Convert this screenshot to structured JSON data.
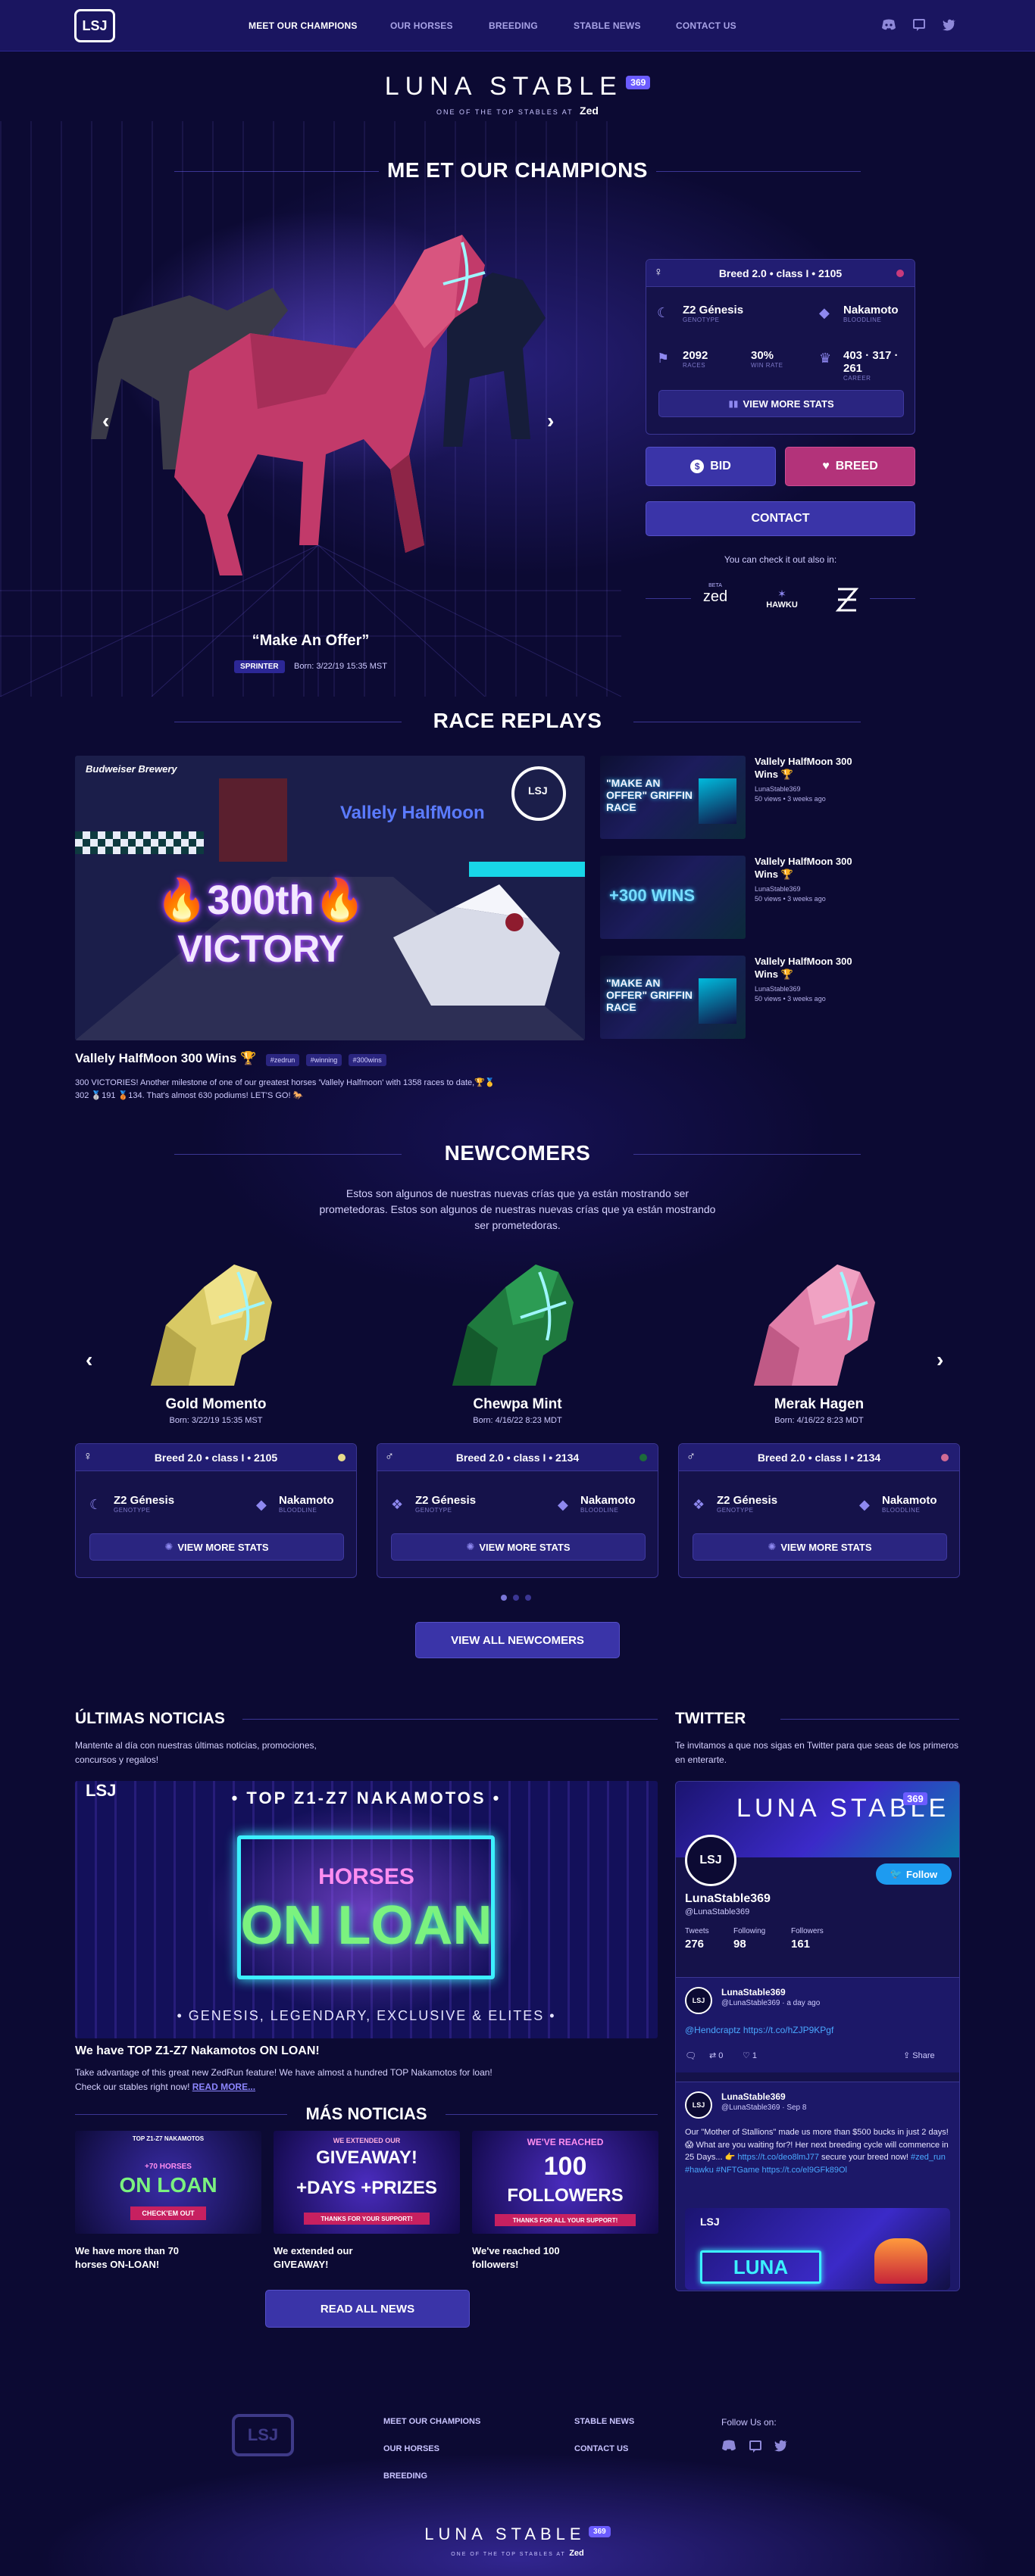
{
  "nav": {
    "logo_text": "LSJ",
    "logo_sub": "369",
    "links": [
      "MEET OUR CHAMPIONS",
      "OUR HORSES",
      "BREEDING",
      "STABLE NEWS",
      "CONTACT US"
    ],
    "social_icons": [
      "discord-icon",
      "chat-icon",
      "twitter-icon"
    ]
  },
  "brand": {
    "title": "LUNA STABLE",
    "badge": "369",
    "subtitle": "ONE OF THE TOP STABLES AT",
    "zed": "Zed"
  },
  "champions": {
    "heading": "ME ET OUR CHAMPIONS",
    "horse_name": "“Make An Offer”",
    "tag": "SPRINTER",
    "born": "Born: 3/22/19 15:35 MST",
    "card": {
      "title": "Breed 2.0 • class I • 2105",
      "gender_symbol": "♀",
      "dot_color": "#c83a7c",
      "genotype_value": "Z2 Génesis",
      "genotype_label": "GENOTYPE",
      "bloodline_value": "Nakamoto",
      "bloodline_label": "BLOODLINE",
      "races_value": "2092",
      "races_label": "RACES",
      "winrate_value": "30%",
      "winrate_label": "WIN RATE",
      "career_value": "403 · 317 · 261",
      "career_label": "CAREER",
      "stats_button": "VIEW MORE STATS"
    },
    "bid_label": "BID",
    "breed_label": "BREED",
    "contact_label": "CONTACT",
    "also_in": "You can check it out also in:",
    "partners": [
      "zed",
      "HAWKU",
      "opensea"
    ],
    "partner_beta": "BETA"
  },
  "replays": {
    "heading": "RACE REPLAYS",
    "main": {
      "title": "Vallely HalfMoon 300 Wins 🏆",
      "hashtags": [
        "#zedrun",
        "#winning",
        "#300wins"
      ],
      "description": "300 VICTORIES! Another milestone of one of our greatest horses 'Vallely Halfmoon' with 1358 races to date,🏆🥇302 🥈191 🥉134. That's almost 630 podiums! LET'S GO! 🐎",
      "overlay_line1": "300th",
      "overlay_line2": "VICTORY",
      "overlay_brand": "Vallely HalfMoon",
      "overlay_sponsor": "Budweiser Brewery"
    },
    "side": [
      {
        "title": "Vallely HalfMoon 300 Wins 🏆",
        "channel": "LunaStable369",
        "meta": "50 views • 3 weeks ago",
        "thumb": "\"MAKE AN OFFER\" GRIFFIN RACE"
      },
      {
        "title": "Vallely HalfMoon 300 Wins 🏆",
        "channel": "LunaStable369",
        "meta": "50 views • 3 weeks ago",
        "thumb": "+300 WINS"
      },
      {
        "title": "Vallely HalfMoon 300 Wins 🏆",
        "channel": "LunaStable369",
        "meta": "50 views • 3 weeks ago",
        "thumb": "\"MAKE AN OFFER\" GRIFFIN RACE"
      }
    ]
  },
  "newcomers": {
    "heading": "NEWCOMERS",
    "intro": "Estos son algunos de nuestras nuevas crías que ya están mostrando ser prometedoras. Estos son algunos de nuestras nuevas crías que ya están mostrando ser prometedoras.",
    "horses": [
      {
        "name": "Gold Momento",
        "born": "Born: 3/22/19 15:35 MST",
        "card_title": "Breed 2.0 • class I • 2105",
        "gender": "♀",
        "dot": "#e8dc8a",
        "genotype": "Z2 Génesis",
        "genotype_label": "GENOTYPE",
        "bloodline": "Nakamoto",
        "bloodline_label": "BLOODLINE",
        "button": "VIEW MORE STATS",
        "color": "#d8c964"
      },
      {
        "name": "Chewpa Mint",
        "born": "Born: 4/16/22 8:23 MDT",
        "card_title": "Breed 2.0 • class I • 2134",
        "gender": "♂",
        "dot": "#1d6b3a",
        "genotype": "Z2 Génesis",
        "genotype_label": "GENOTYPE",
        "bloodline": "Nakamoto",
        "bloodline_label": "BLOODLINE",
        "button": "VIEW MORE STATS",
        "color": "#1f7a3e"
      },
      {
        "name": "Merak Hagen",
        "born": "Born: 4/16/22 8:23 MDT",
        "card_title": "Breed 2.0 • class I • 2134",
        "gender": "♂",
        "dot": "#d06a94",
        "genotype": "Z2 Génesis",
        "genotype_label": "GENOTYPE",
        "bloodline": "Nakamoto",
        "bloodline_label": "BLOODLINE",
        "button": "VIEW MORE STATS",
        "color": "#e07ea8"
      }
    ],
    "view_all": "VIEW ALL NEWCOMERS"
  },
  "news": {
    "heading": "ÚLTIMAS NOTICIAS",
    "intro": "Mantente al día con nuestras últimas noticias, promociones, concursos y regalos!",
    "banner_top": "• TOP Z1-Z7 NAKAMOTOS •",
    "banner_line1": "HORSES",
    "banner_line2": "ON LOAN",
    "banner_bottom": "• GENESIS, LEGENDARY, EXCLUSIVE & ELITES •",
    "feature_title": "We have TOP Z1-Z7 Nakamotos ON LOAN!",
    "feature_text": "Take advantage of this great new ZedRun feature! We have almost a hundred TOP Nakamotos for loan! Check our stables right now!",
    "read_more": "READ MORE...",
    "more_heading": "MÁS NOTICIAS",
    "cards": [
      {
        "thumb_top": "TOP Z1-Z7 NAKAMOTOS",
        "thumb_main": "ON LOAN",
        "thumb_pre": "+70 HORSES",
        "thumb_cta": "CHECK'EM OUT",
        "text": "We have more than 70 horses ON-LOAN!"
      },
      {
        "thumb_top": "WE EXTENDED OUR",
        "thumb_main": "GIVEAWAY!",
        "thumb_pre": "+DAYS +PRIZES",
        "thumb_cta": "THANKS FOR YOUR SUPPORT!",
        "text": "We extended our GIVEAWAY!"
      },
      {
        "thumb_top": "WE'VE REACHED",
        "thumb_main": "100",
        "thumb_pre": "FOLLOWERS",
        "thumb_cta": "THANKS FOR ALL YOUR SUPPORT!",
        "text": "We've reached 100 followers!"
      }
    ],
    "read_all": "READ ALL NEWS"
  },
  "twitter": {
    "heading": "TWITTER",
    "intro": "Te invitamos a que nos sigas en Twitter para que seas de los primeros en enterarte.",
    "banner_title": "LUNA STABLE",
    "banner_badge": "369",
    "profile_name": "LunaStable369",
    "handle": "@LunaStable369",
    "follow": "Follow",
    "tweets_label": "Tweets",
    "tweets_value": "276",
    "following_label": "Following",
    "following_value": "98",
    "followers_label": "Followers",
    "followers_value": "161",
    "tweet1": {
      "name": "LunaStable369",
      "handle": "@LunaStable369 · a day ago",
      "text": "@Hendcraptz https://t.co/hZJP9KPgf",
      "replies": "",
      "retweets": "0",
      "likes": "1",
      "share": "Share"
    },
    "tweet2": {
      "name": "LunaStable369",
      "handle": "@LunaStable369 · Sep 8",
      "text_a": "Our \"Mother of Stallions\" made us more than $500 bucks in just 2 days! 😱 What are you waiting for?! Her next breeding cycle will commence in 25 Days... 👉",
      "link1": "https://t.co/deo8lmJ77",
      "text_b": "secure your breed now!",
      "link2": "#zed_run #hawku #NFTGame",
      "link3": "https://t.co/el9GFk89Ol",
      "media_text": "LUNA"
    }
  },
  "footer": {
    "links_col1": [
      "MEET OUR CHAMPIONS",
      "OUR HORSES",
      "BREEDING"
    ],
    "links_col2": [
      "STABLE NEWS",
      "CONTACT US"
    ],
    "follow_label": "Follow Us on:",
    "social_icons": [
      "discord-icon",
      "chat-icon",
      "twitter-icon"
    ],
    "brand_title": "LUNA STABLE",
    "brand_badge": "369",
    "brand_sub": "ONE OF THE TOP STABLES AT",
    "brand_zed": "Zed"
  }
}
